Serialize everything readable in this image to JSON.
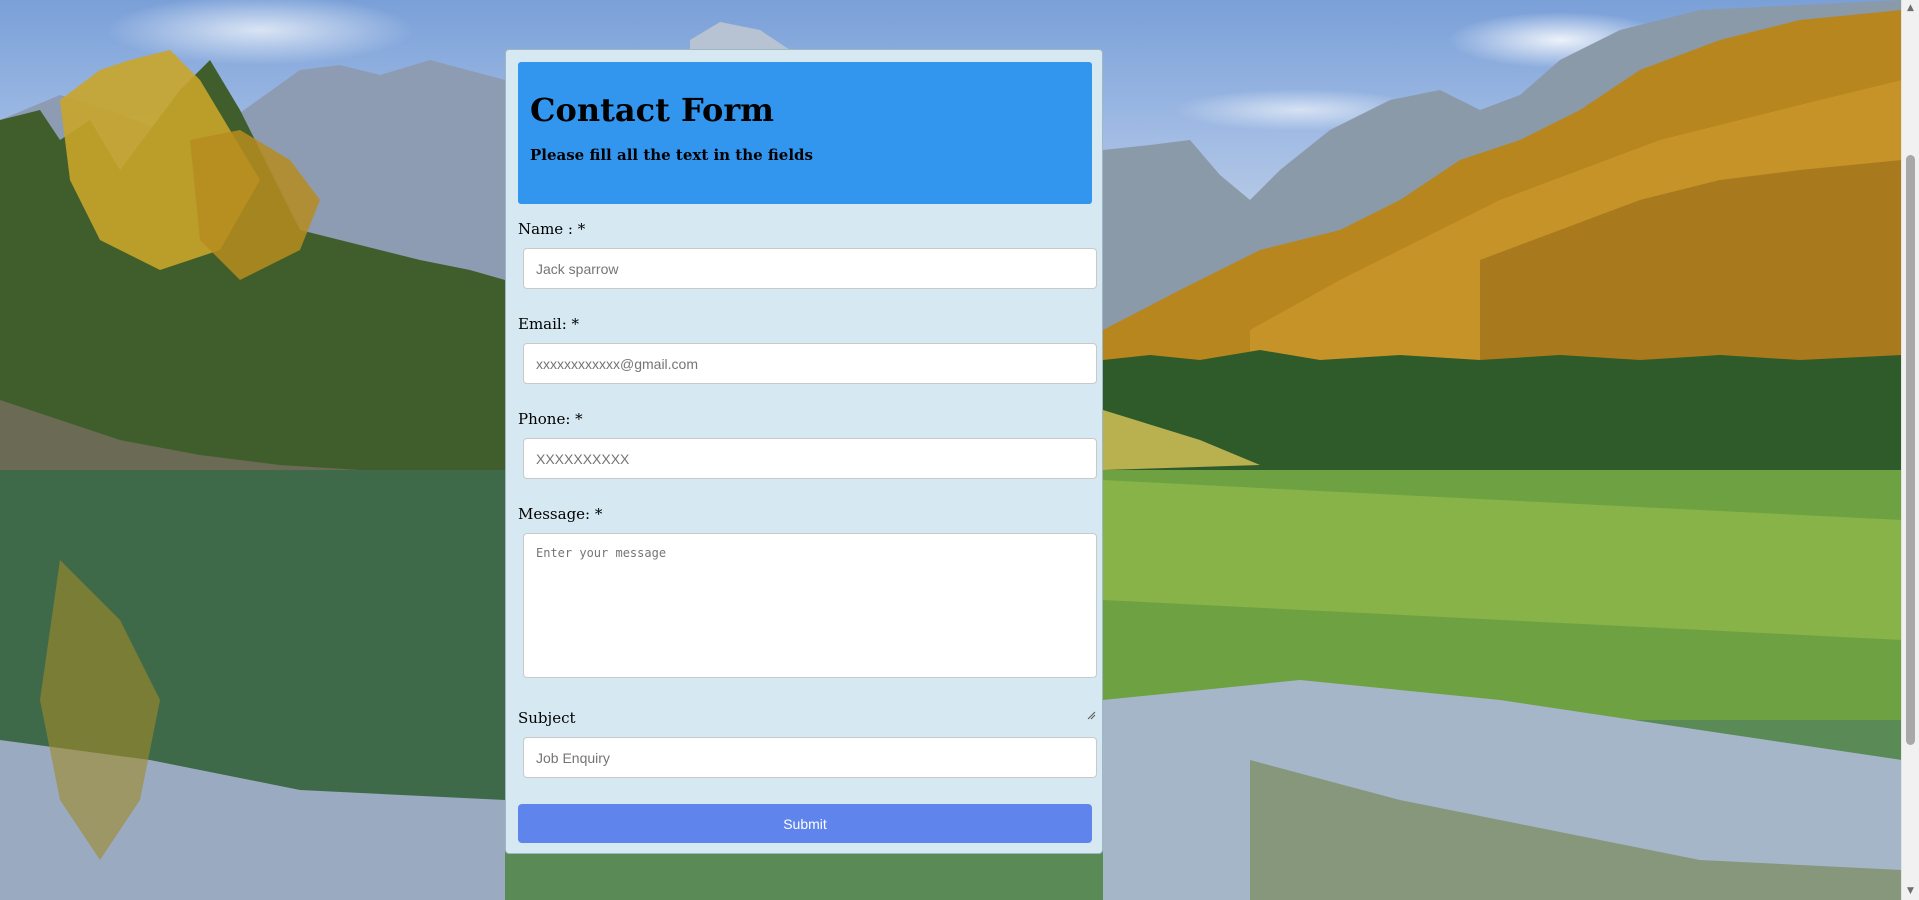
{
  "header": {
    "title": "Contact Form",
    "subtitle": "Please fill all the text in the fields"
  },
  "fields": {
    "name": {
      "label": "Name : *",
      "placeholder": "Jack sparrow",
      "value": ""
    },
    "email": {
      "label": "Email: *",
      "placeholder": "xxxxxxxxxxxx@gmail.com",
      "value": ""
    },
    "phone": {
      "label": "Phone: *",
      "placeholder": "XXXXXXXXXX",
      "value": ""
    },
    "message": {
      "label": "Message: *",
      "placeholder": "Enter your message",
      "value": ""
    },
    "subject": {
      "label": "Subject",
      "placeholder": "Job Enquiry",
      "value": ""
    }
  },
  "submit": {
    "label": "Submit"
  },
  "scrollbar": {
    "up_icon": "▲",
    "down_icon": "▼"
  },
  "colors": {
    "header_bg": "#3296ef",
    "card_bg": "#d6e8f1",
    "submit_bg": "#5f85ed"
  }
}
